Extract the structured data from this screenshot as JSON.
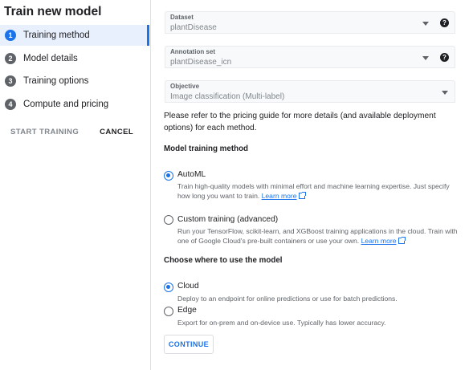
{
  "sidebar": {
    "title": "Train new model",
    "steps": [
      {
        "num": "1",
        "label": "Training method",
        "active": true
      },
      {
        "num": "2",
        "label": "Model details"
      },
      {
        "num": "3",
        "label": "Training options"
      },
      {
        "num": "4",
        "label": "Compute and pricing"
      }
    ],
    "start_label": "START TRAINING",
    "cancel_label": "CANCEL"
  },
  "form": {
    "dataset": {
      "label": "Dataset",
      "value": "plantDisease"
    },
    "annotation_set": {
      "label": "Annotation set",
      "value": "plantDisease_icn"
    },
    "objective": {
      "label": "Objective",
      "value": "Image classification (Multi-label)"
    },
    "help_glyph": "?",
    "description": "Please refer to the pricing guide for more details (and available deployment options) for each method.",
    "method_title": "Model training method",
    "methods": [
      {
        "title": "AutoML",
        "desc": "Train high-quality models with minimal effort and machine learning expertise. Just specify how long you want to train.",
        "link": "Learn more",
        "checked": true
      },
      {
        "title": "Custom training (advanced)",
        "desc": "Run your TensorFlow, scikit-learn, and XGBoost training applications in the cloud. Train with one of Google Cloud's pre-built containers or use your own.",
        "link": "Learn more",
        "checked": false
      }
    ],
    "use_title": "Choose where to use the model",
    "targets": [
      {
        "title": "Cloud",
        "desc": "Deploy to an endpoint for online predictions or use for batch predictions.",
        "checked": true
      },
      {
        "title": "Edge",
        "desc": "Export for on-prem and on-device use. Typically has lower accuracy.",
        "checked": false
      }
    ],
    "continue_label": "CONTINUE"
  },
  "colors": {
    "accent": "#1a73e8",
    "active_bg": "#e8f0fe"
  }
}
